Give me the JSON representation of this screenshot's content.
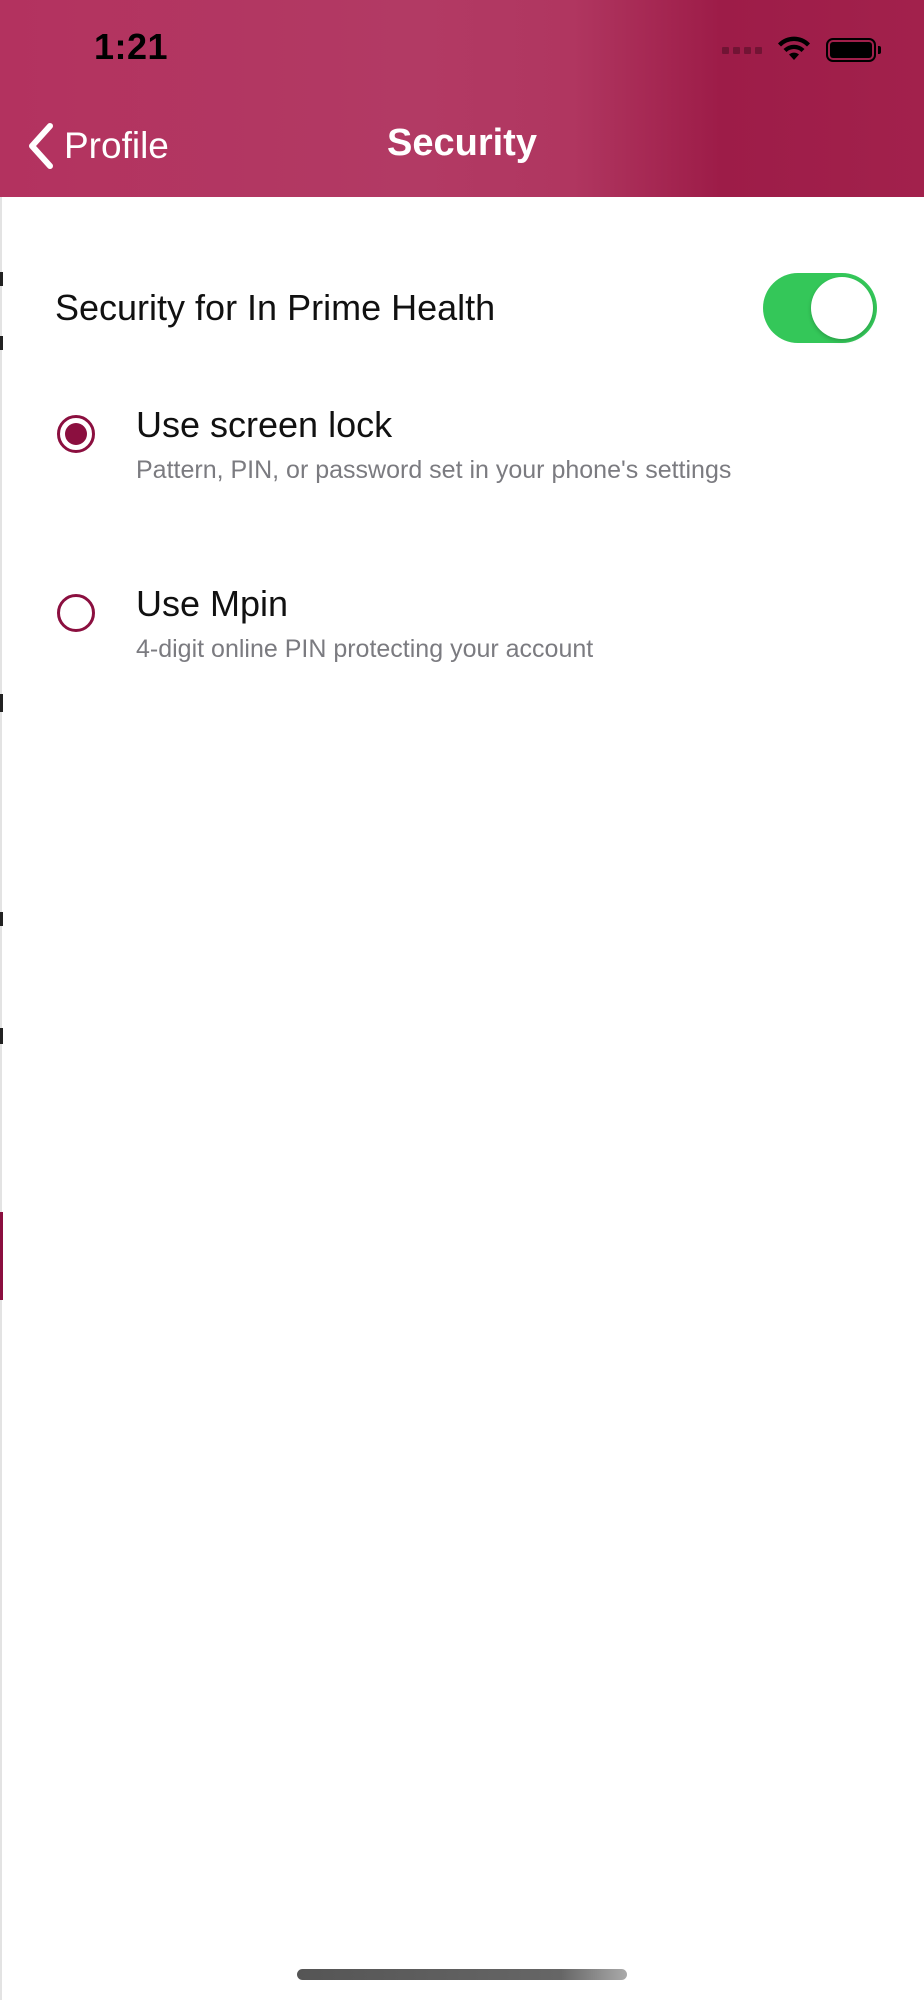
{
  "status_bar": {
    "time": "1:21",
    "wifi_icon": "wifi-icon",
    "battery_icon": "battery-icon"
  },
  "nav": {
    "back_label": "Profile",
    "back_icon": "chevron-left-icon",
    "title": "Security"
  },
  "security": {
    "toggle_label": "Security for In Prime Health",
    "toggle_on": true,
    "options": [
      {
        "title": "Use screen lock",
        "description": "Pattern, PIN, or password set in your phone's settings",
        "selected": true
      },
      {
        "title": "Use Mpin",
        "description": "4-digit online PIN protecting your account",
        "selected": false
      }
    ]
  },
  "colors": {
    "header_gradient_start": "#b3325f",
    "header_gradient_end": "#9d1c48",
    "toggle_on": "#34c759",
    "radio_accent": "#8b0f3f",
    "description_text": "#7b7b80"
  }
}
